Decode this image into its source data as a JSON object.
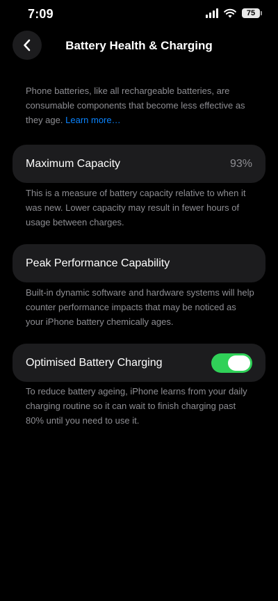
{
  "status_bar": {
    "time": "7:09",
    "battery_level": "75",
    "icons": [
      "cellular-signal-icon",
      "wifi-icon",
      "battery-icon"
    ]
  },
  "nav": {
    "title": "Battery Health & Charging",
    "back_icon": "chevron-left-icon"
  },
  "intro": {
    "text": "Phone batteries, like all rechargeable batteries, are consumable components that become less effective as they age.",
    "link": "Learn more…"
  },
  "max_capacity": {
    "label": "Maximum Capacity",
    "value": "93%",
    "description": "This is a measure of battery capacity relative to when it was new. Lower capacity may result in fewer hours of usage between charges."
  },
  "peak_performance": {
    "label": "Peak Performance Capability",
    "description": "Built-in dynamic software and hardware systems will help counter performance impacts that may be noticed as your iPhone battery chemically ages."
  },
  "optimised_charging": {
    "label": "Optimised Battery Charging",
    "enabled": true,
    "description": "To reduce battery ageing, iPhone learns from your daily charging routine so it can wait to finish charging past 80% until you need to use it."
  },
  "colors": {
    "background": "#000000",
    "cell_background": "#1c1c1e",
    "secondary_text": "#8e8e93",
    "link": "#0a84ff",
    "toggle_on": "#30d158"
  }
}
